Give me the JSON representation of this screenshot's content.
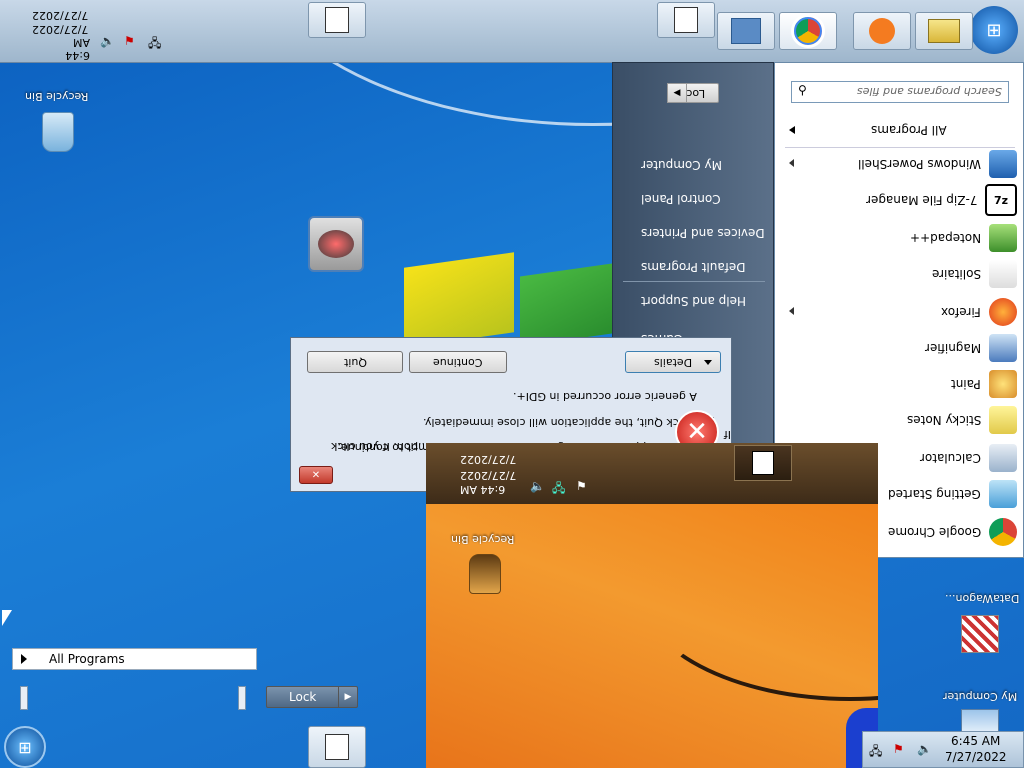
{
  "desktop": {
    "icons": {
      "recycle_bin": "Recycle Bin",
      "recycle_bin_orange": "Recycle Bin",
      "datawagon": "DataWagon...",
      "my_computer": "My Computer"
    }
  },
  "start_menu": {
    "search_placeholder": "Search programs and files",
    "all_programs": "All Programs",
    "programs": [
      {
        "label": "Google Chrome",
        "icon": "chrome-icon"
      },
      {
        "label": "Getting Started",
        "icon": "getting-started-icon"
      },
      {
        "label": "Calculator",
        "icon": "calculator-icon"
      },
      {
        "label": "Sticky Notes",
        "icon": "sticky-notes-icon"
      },
      {
        "label": "Paint",
        "icon": "paint-icon"
      },
      {
        "label": "Magnifier",
        "icon": "magnifier-icon"
      },
      {
        "label": "Firefox",
        "icon": "firefox-icon"
      },
      {
        "label": "Solitaire",
        "icon": "solitaire-icon"
      },
      {
        "label": "Notepad++",
        "icon": "notepadpp-icon"
      },
      {
        "label": "7-Zip File Manager",
        "icon": "7zip-icon"
      },
      {
        "label": "Windows PowerShell",
        "icon": "powershell-icon"
      }
    ],
    "right_links": [
      "My Computer",
      "Control Panel",
      "Devices and Printers",
      "Default Programs",
      "Help and Support"
    ],
    "right_partial": [
      "Games"
    ],
    "lock_label": "Lock"
  },
  "dialog": {
    "message_line1": "A generic error occurred in GDI+.",
    "message_line2": "you click Quit, the application will close immediately.",
    "message_line3": "Continue, the application will ignore this error and attempt to continue. If",
    "message_line4": "...tion. If you click",
    "details": "Details",
    "continue": "Continue",
    "quit": "Quit"
  },
  "taskbar": {
    "top_time": "6:44 AM",
    "top_date1": "7/27/2022",
    "top_date2": "7/27/2022",
    "orange_time": "6:44 AM",
    "orange_date1": "7/27/2022",
    "orange_date2": "7/27/2022",
    "time": "6:45 AM",
    "date": "7/27/2022"
  },
  "bottom_start": {
    "all_programs": "All Programs",
    "lock_label": "Lock"
  },
  "colors": {
    "desktop_blue": "#1b7ed6",
    "orange_bg": "#f39a2f",
    "error_red": "#d9231f"
  }
}
